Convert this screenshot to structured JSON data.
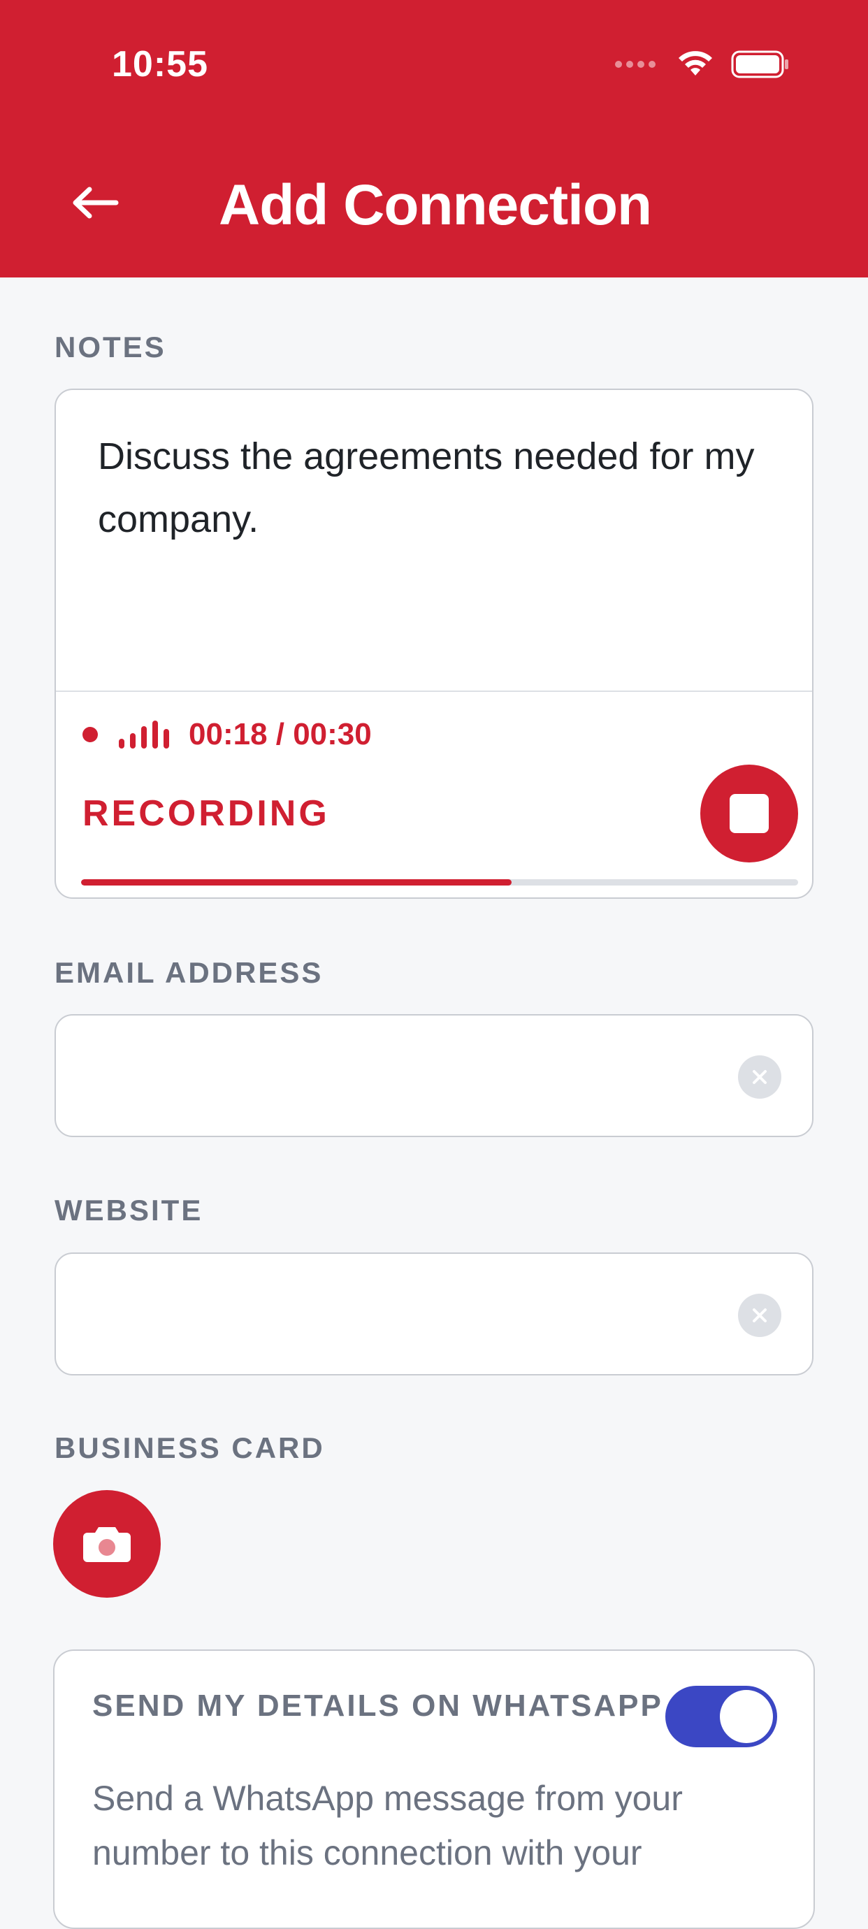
{
  "status_bar": {
    "time": "10:55"
  },
  "header": {
    "title": "Add Connection",
    "back_icon": "arrow-left-icon"
  },
  "notes": {
    "label": "NOTES",
    "text": "Discuss the agreements needed for my company.",
    "recording": {
      "elapsed": "00:18",
      "total": "00:30",
      "time_text": "00:18 / 00:30",
      "status_label": "RECORDING",
      "progress_fraction": 0.6
    }
  },
  "email": {
    "label": "EMAIL ADDRESS",
    "value": "",
    "placeholder": ""
  },
  "website": {
    "label": "WEBSITE",
    "value": "",
    "placeholder": ""
  },
  "business_card": {
    "label": "BUSINESS CARD",
    "icon": "camera-icon"
  },
  "whatsapp": {
    "title": "SEND MY DETAILS ON WHATSAPP",
    "enabled": true,
    "description": "Send a WhatsApp message from your number to this connection with your"
  },
  "colors": {
    "brand_red": "#D01F31",
    "toggle_blue": "#3B47C4",
    "label_gray": "#6B7280",
    "background": "#F6F7F9"
  }
}
